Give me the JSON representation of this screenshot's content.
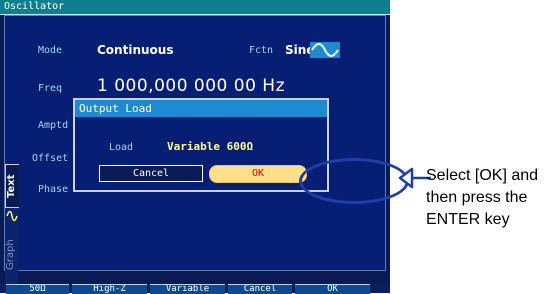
{
  "window": {
    "title": "Oscillator"
  },
  "params": {
    "mode": {
      "label": "Mode",
      "value": "Continuous"
    },
    "fctn": {
      "label": "Fctn",
      "value": "Sine"
    },
    "freq": {
      "label": "Freq",
      "value": "1 000,000 000 00 Hz"
    },
    "amptd": {
      "label": "Amptd"
    },
    "offset": {
      "label": "Offset"
    },
    "phase": {
      "label": "Phase"
    }
  },
  "side_tabs": {
    "text": "Text",
    "graph": "Graph"
  },
  "dialog": {
    "title": "Output Load",
    "load_label": "Load",
    "load_value": "Variable  600Ω",
    "cancel": "Cancel",
    "ok": "OK"
  },
  "softkeys": [
    "50Ω",
    "High-Z",
    "Variable",
    "Cancel",
    "OK"
  ],
  "annotation": "Select [OK] and then press the ENTER key",
  "colors": {
    "screen_bg": "#061e73",
    "dialog_title": "#1d8ad1",
    "ok_fill": "#ffe08a",
    "ok_text": "#d80000",
    "highlight": "#1f3fa8"
  }
}
